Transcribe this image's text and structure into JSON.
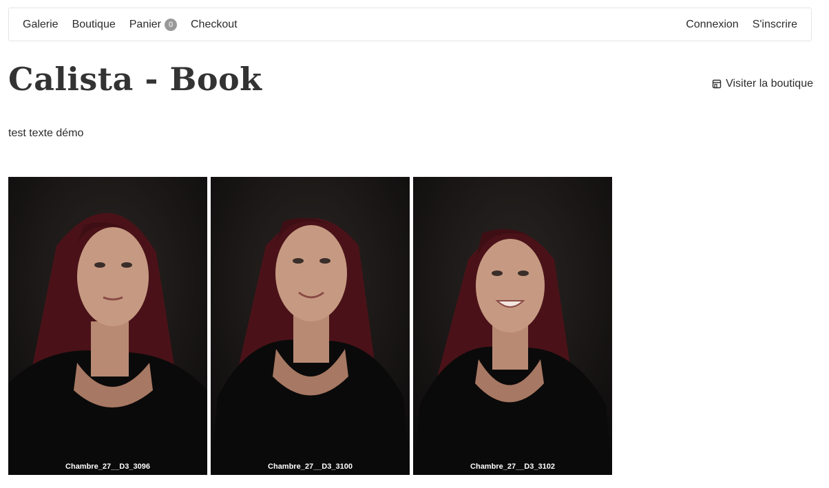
{
  "nav": {
    "left": [
      {
        "label": "Galerie"
      },
      {
        "label": "Boutique"
      },
      {
        "label": "Panier",
        "badge": "0"
      },
      {
        "label": "Checkout"
      }
    ],
    "right": [
      {
        "label": "Connexion"
      },
      {
        "label": "S'inscrire"
      }
    ]
  },
  "page": {
    "title": "Calista - Book",
    "shop_link": "Visiter la boutique",
    "description": "test texte démo"
  },
  "gallery": [
    {
      "caption": "Chambre_27__D3_3096"
    },
    {
      "caption": "Chambre_27__D3_3100"
    },
    {
      "caption": "Chambre_27__D3_3102"
    }
  ],
  "icons": {
    "shop": "store-icon"
  }
}
